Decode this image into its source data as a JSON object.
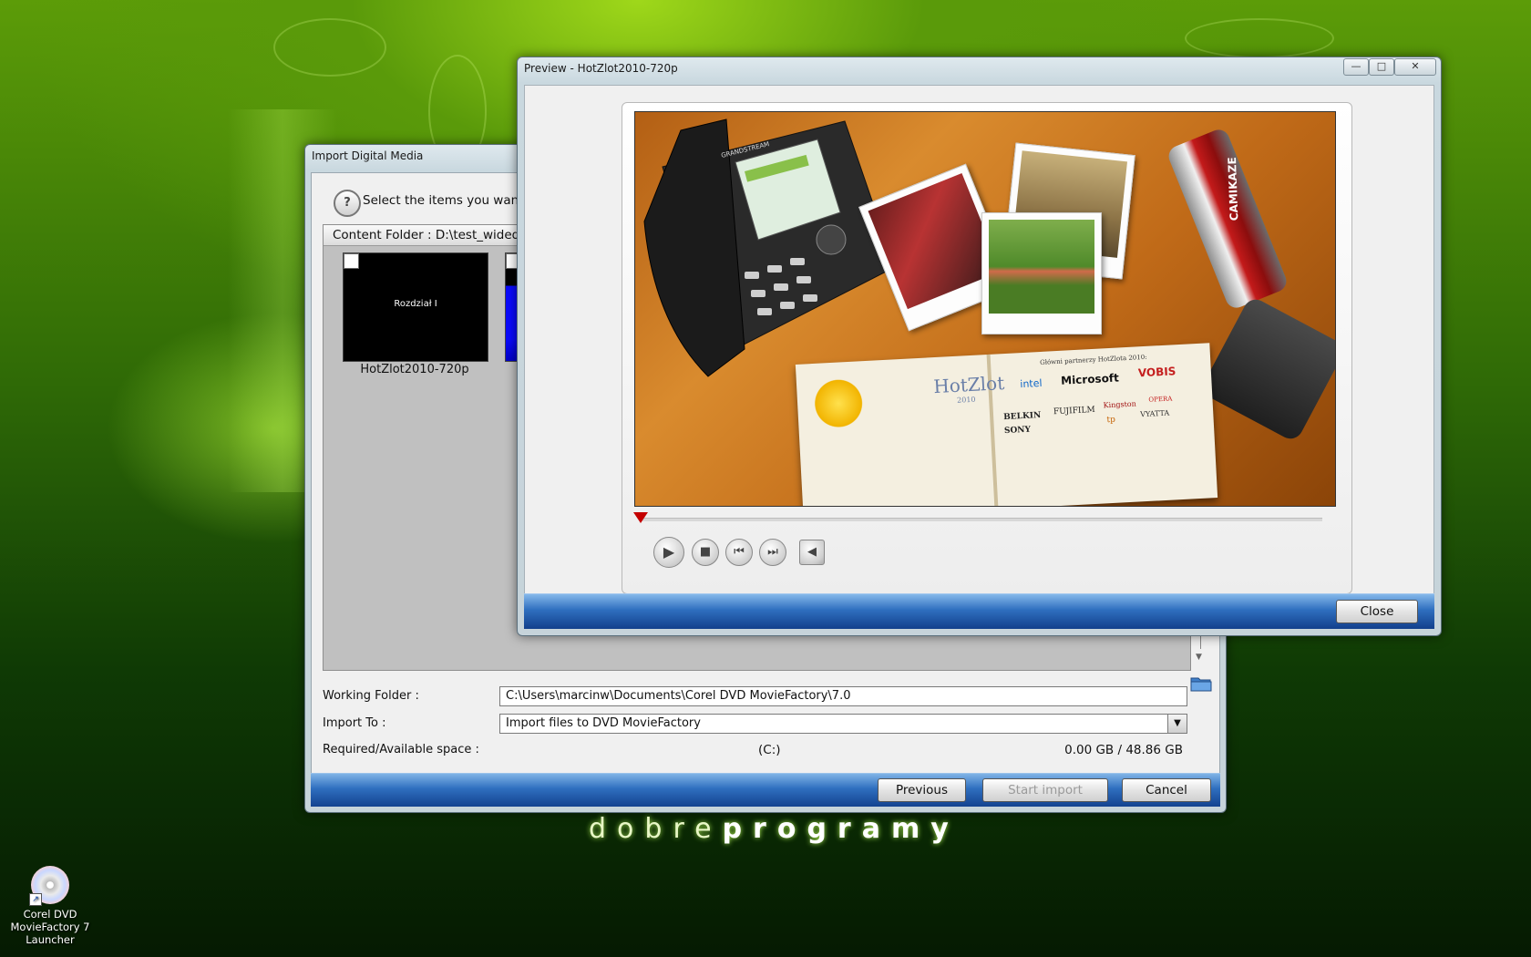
{
  "desktop": {
    "brand_light": "dobre",
    "brand_bold": "programy",
    "icon_label": "Corel DVD MovieFactory 7 Launcher",
    "icon": "corel-disc-icon"
  },
  "import_dialog": {
    "title": "Import Digital Media",
    "instruction": "Select the items you want t",
    "content_folder": "Content Folder : D:\\test_wided",
    "thumbnails": [
      {
        "caption": "Rozdział I",
        "label": "HotZlot2010-720p"
      }
    ],
    "working_folder_label": "Working Folder :",
    "working_folder_value": "C:\\Users\\marcinw\\Documents\\Corel DVD MovieFactory\\7.0",
    "import_to_label": "Import To :",
    "import_to_value": "Import files to DVD MovieFactory",
    "space_label": "Required/Available space :",
    "drive": "(C:)",
    "space_value": "0.00 GB / 48.86 GB",
    "buttons": {
      "previous": "Previous",
      "start_import": "Start import",
      "cancel": "Cancel"
    }
  },
  "preview_window": {
    "title": "Preview - HotZlot2010-720p",
    "controls": {
      "minimize": "—",
      "maximize": "□",
      "close": "✕"
    },
    "close_button": "Close",
    "playback_progress": 0.0,
    "video_scene": {
      "notebook_title": "HotZlot",
      "notebook_year": "2010",
      "sponsors_heading": "Główni partnerzy HotZlota 2010:",
      "sponsors": [
        "intel",
        "Microsoft",
        "VOBIS",
        "BELKIN",
        "FUJIFILM",
        "Kingston",
        "OPERA",
        "SONY",
        "tp",
        "VYATTA"
      ],
      "phone_brand": "GRANDSTREAM",
      "can_text": "CAMIKAZE"
    }
  },
  "colors": {
    "accent_blue": "#2f6fbf",
    "marker_red": "#c40000"
  }
}
